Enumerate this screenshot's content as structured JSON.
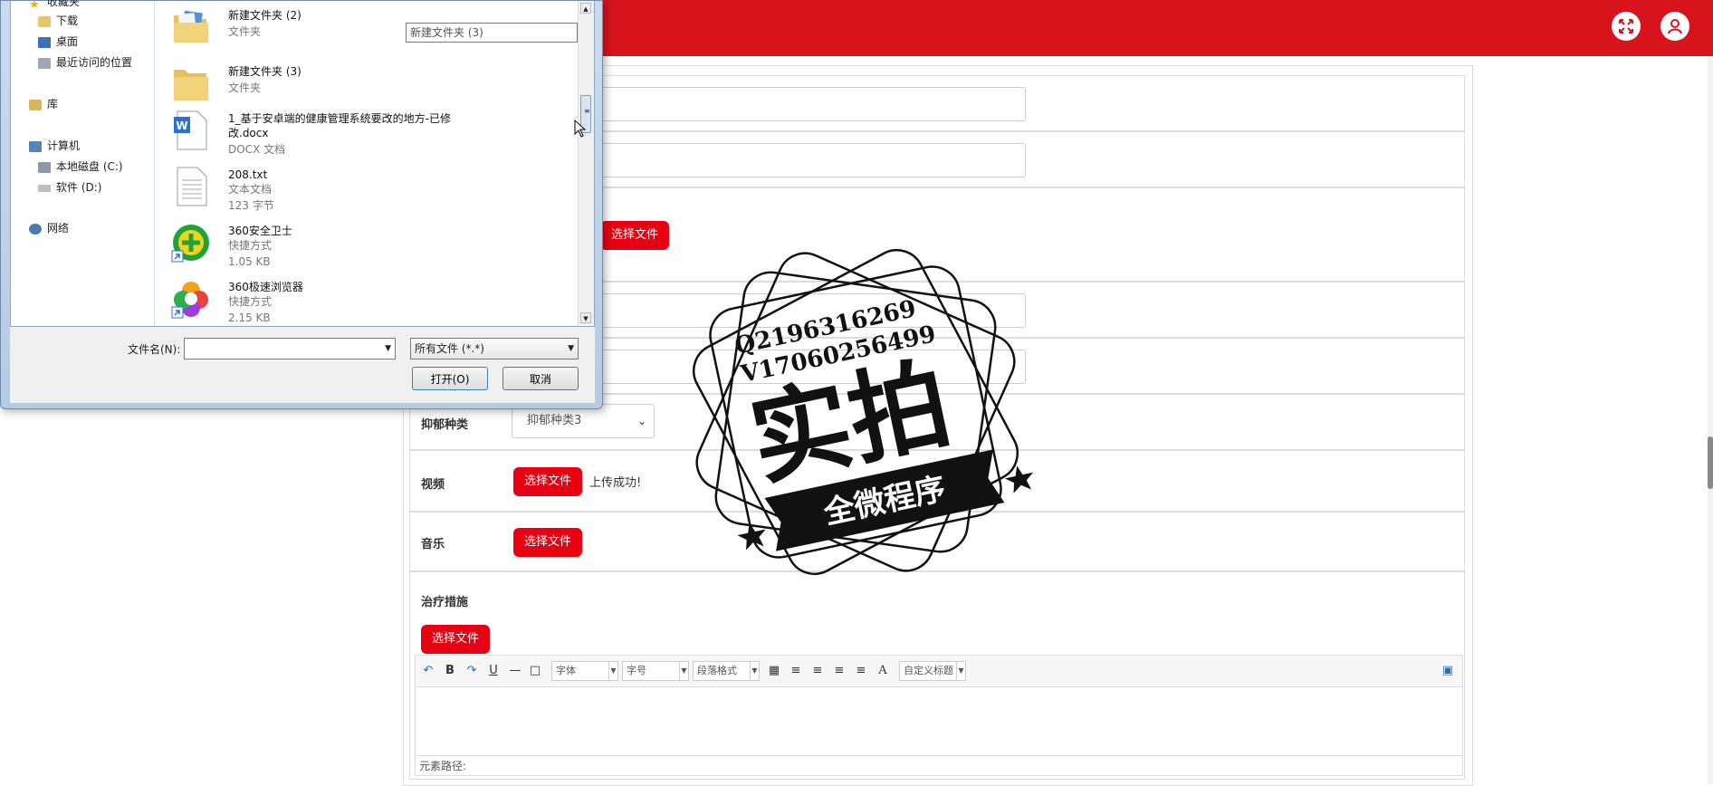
{
  "dialog": {
    "nav": {
      "favorites": "收藏夹",
      "downloads": "下载",
      "desktop": "桌面",
      "recent": "最近访问的位置",
      "libraries": "库",
      "computer": "计算机",
      "drive_c": "本地磁盘 (C:)",
      "drive_d": "软件 (D:)",
      "network": "网络"
    },
    "files": [
      {
        "name": "新建文件夹 (2)",
        "type": "文件夹",
        "size": "",
        "icon": "folder-icon"
      },
      {
        "name": "新建文件夹 (3)",
        "type": "文件夹",
        "size": "",
        "icon": "folder-icon"
      },
      {
        "name": "1_基于安卓端的健康管理系统要改的地方-已修改.docx",
        "type": "DOCX 文档",
        "size": "",
        "icon": "docx-icon"
      },
      {
        "name": "208.txt",
        "type": "文本文档",
        "size": "123 字节",
        "icon": "txt-icon"
      },
      {
        "name": "360安全卫士",
        "type": "快捷方式",
        "size": "1.05 KB",
        "icon": "360-safe-icon"
      },
      {
        "name": "360极速浏览器",
        "type": "快捷方式",
        "size": "2.15 KB",
        "icon": "360-browser-icon"
      }
    ],
    "rename_value": "新建文件夹 (3)",
    "filename_label": "文件名(N):",
    "filename_value": "",
    "filetype_value": "所有文件 (*.*)",
    "open_label": "打开(O)",
    "cancel_label": "取消"
  },
  "form": {
    "choose_file_label": "选择文件",
    "depression_type": {
      "label": "抑郁种类",
      "value": "抑郁种类3"
    },
    "video": {
      "label": "视频",
      "status": "上传成功!"
    },
    "music": {
      "label": "音乐"
    },
    "treatment": {
      "label": "治疗措施"
    },
    "editor": {
      "font_placeholder": "字体",
      "size_placeholder": "字号",
      "paragraph_placeholder": "段落格式",
      "custom_title": "自定义标题",
      "element_path": "元素路径:"
    }
  },
  "watermark": {
    "line1": "Q2196316269",
    "line2": "V17060256499",
    "big_text": "实拍",
    "banner": "全微程序"
  },
  "colors": {
    "brand_red": "#d7141c",
    "button_red": "#e60012"
  }
}
